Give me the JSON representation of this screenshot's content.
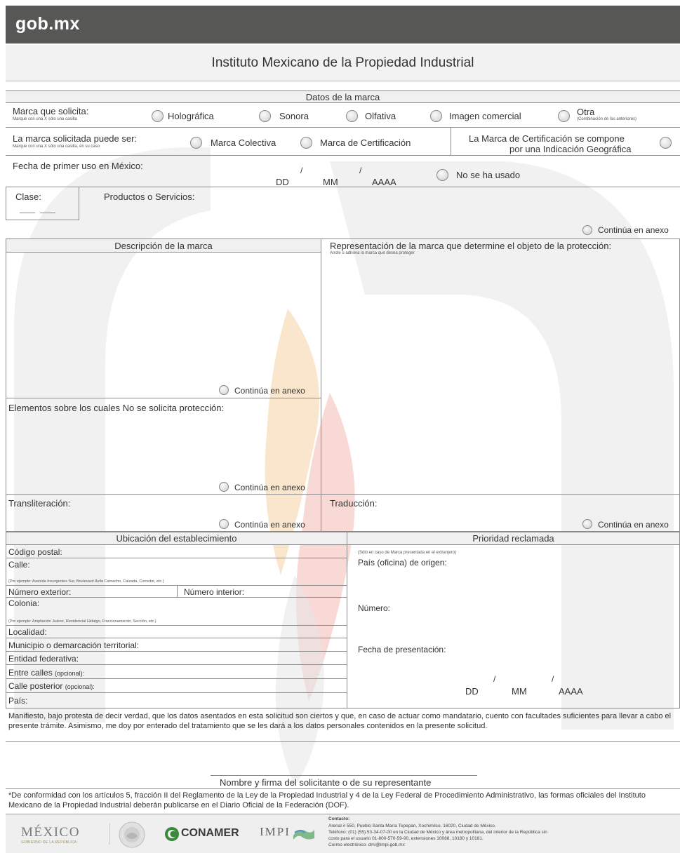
{
  "header": {
    "logo": "gob.mx",
    "title": "Instituto Mexicano de la Propiedad Industrial"
  },
  "datos": {
    "section_title": "Datos de la marca",
    "marca_label": "Marca que solicita:",
    "marca_hint": "Marque con una X sólo una casilla",
    "options": [
      "Holográfica",
      "Sonora",
      "Olfativa",
      "Imagen comercial",
      "Otra"
    ],
    "otra_hint": "(Combinación de las anteriores)",
    "puede_label": "La marca solicitada puede ser:",
    "puede_hint": "Marque con una X sólo una casilla, en su caso",
    "colectiva": "Marca Colectiva",
    "certificacion": "Marca de Certificación",
    "geo_1": "La Marca de Certificación se compone",
    "geo_2": "por una Indicación Geográfica",
    "fecha_label": "Fecha de primer uso en México:",
    "dd": "DD",
    "mm": "MM",
    "aaaa": "AAAA",
    "slash": "/",
    "no_usado": "No se ha usado",
    "clase": "Clase:",
    "productos": "Productos o Servicios:",
    "anexo": "Continúa en anexo"
  },
  "desc": {
    "title": "Descripción de la marca",
    "rep_title": "Representación de la marca que determine el objeto de la protección:",
    "rep_hint": "Anote o adhiera la marca que desea proteger",
    "elementos": "Elementos sobre los cuales No se solicita protección:",
    "transliteracion": "Transliteración:",
    "traduccion": "Traducción:"
  },
  "ubicacion": {
    "title": "Ubicación del establecimiento",
    "cp": "Código postal:",
    "calle": "Calle:",
    "calle_hint": "(Por ejemplo: Avenida Insurgentes Sur, Boulevard Ávila Camacho, Calzada, Corredor, etc.)",
    "num_ext": "Número exterior:",
    "num_int": "Número interior:",
    "colonia": "Colonia:",
    "colonia_hint": "(Por ejemplo: Ampliación Juárez, Residencial Hidalgo, Fraccionamiento, Sección, etc.)",
    "localidad": "Localidad:",
    "municipio": "Municipio o demarcación territorial:",
    "entidad": "Entidad federativa:",
    "entre": "Entre calles",
    "calle_post": "Calle posterior",
    "opcional": "(opcional):",
    "pais": "País:"
  },
  "prioridad": {
    "title": "Prioridad reclamada",
    "hint": "(Sólo en caso de Marca presentada en el extranjero)",
    "pais_origen": "País (oficina) de origen:",
    "numero": "Número:",
    "fecha": "Fecha de presentación:"
  },
  "manifiesto": "Manifiesto, bajo protesta de decir verdad, que los datos asentados en esta solicitud son ciertos y que, en caso de actuar como mandatario, cuento con facultades suficientes para llevar a cabo el presente trámite. Asimismo, me doy por enterado del tratamiento que se les dará a los datos personales contenidos en la presente solicitud.",
  "firma": "Nombre y firma del solicitante o de su representante",
  "nota": "*De conformidad con los artículos 5, fracción II del Reglamento de la Ley de la Propiedad Industrial y 4 de la Ley Federal de Procedimiento Administrativo, las formas oficiales del Instituto Mexicano de la Propiedad Industrial deberán publicarse en el Diario Oficial de la Federación (DOF).",
  "footer": {
    "mexico": "MÉXICO",
    "gobierno": "GOBIERNO DE LA REPÚBLICA",
    "conamer": "CONAMER",
    "impi": "IMPI",
    "contacto_title": "Contacto:",
    "contacto_1": "Arenal # 550, Pueblo Santa María Tepepan, Xochimilco, 16020, Ciudad de México.",
    "contacto_2": "Teléfono: (01) (55) 53-34-07-00 en la Ciudad de México y área metropolitana, del interior de la República sin",
    "contacto_3": "costo para el usuario 01-800-570-59-90, extensiones 10088, 10180 y 10181.",
    "contacto_4": "Correo electrónico: dmi@impi.gob.mx"
  },
  "colors": {
    "header": "#575756",
    "watermark_gray": "#d9d9d9",
    "watermark_orange": "#f6d2a4",
    "watermark_red": "#f1b4ad"
  }
}
